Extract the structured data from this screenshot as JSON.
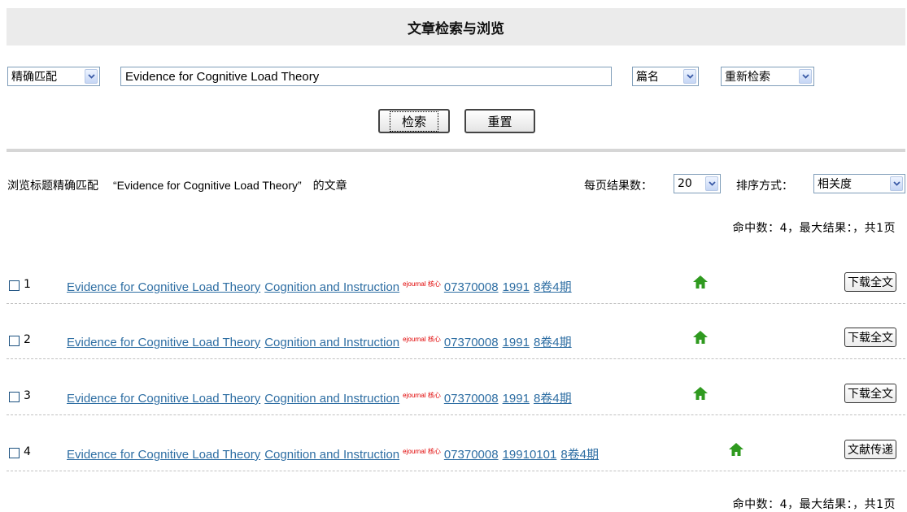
{
  "header": {
    "title": "文章检索与浏览"
  },
  "search": {
    "match_mode": "精确匹配",
    "query": "Evidence for Cognitive Load Theory",
    "field": "篇名",
    "scope": "重新检索",
    "search_label": "检索",
    "reset_label": "重置"
  },
  "summary": {
    "prefix": "浏览标题精确匹配",
    "query_quoted": "“Evidence for Cognitive Load Theory”",
    "suffix": "的文章",
    "per_page_label": "每页结果数：",
    "per_page_value": "20",
    "sort_label": "排序方式：",
    "sort_value": "相关度",
    "hits_text": "命中数：4，最大结果：，共1页"
  },
  "results": [
    {
      "num": "1",
      "title": "Evidence for Cognitive Load Theory",
      "journal": "Cognition and Instruction",
      "tag": "ejournal 核心",
      "issn": "07370008",
      "year": "1991",
      "issue": "8卷4期",
      "action": "下载全文"
    },
    {
      "num": "2",
      "title": "Evidence for Cognitive Load Theory",
      "journal": "Cognition and Instruction",
      "tag": "ejournal 核心",
      "issn": "07370008",
      "year": "1991",
      "issue": "8卷4期",
      "action": "下载全文"
    },
    {
      "num": "3",
      "title": "Evidence for Cognitive Load Theory",
      "journal": "Cognition and Instruction",
      "tag": "ejournal 核心",
      "issn": "07370008",
      "year": "1991",
      "issue": "8卷4期",
      "action": "下载全文"
    },
    {
      "num": "4",
      "title": "Evidence for Cognitive Load Theory",
      "journal": "Cognition and Instruction",
      "tag": "ejournal 核心",
      "issn": "07370008",
      "year": "19910101",
      "issue": "8卷4期",
      "action": "文献传递"
    }
  ],
  "footer": {
    "hits_text": "命中数：4，最大结果：，共1页"
  },
  "colors": {
    "link": "#2e6ea3",
    "tag": "#e00000",
    "home_icon": "#2f9a1f",
    "title_bar": "#ebebeb"
  },
  "icons": {
    "dropdown": "chevron-down-icon",
    "home": "home-icon"
  }
}
